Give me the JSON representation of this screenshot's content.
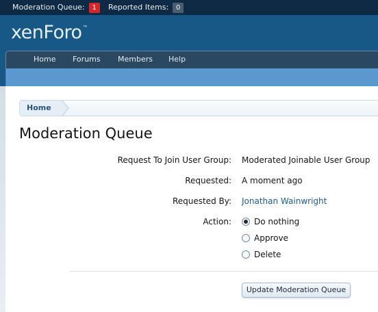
{
  "topbar": {
    "moderation_queue_label": "Moderation Queue:",
    "moderation_queue_count": "1",
    "reported_items_label": "Reported Items:",
    "reported_items_count": "0"
  },
  "header": {
    "logo_text": "xenForo",
    "logo_tm": "™"
  },
  "nav": {
    "tabs": [
      {
        "label": "Home"
      },
      {
        "label": "Forums"
      },
      {
        "label": "Members"
      },
      {
        "label": "Help"
      }
    ]
  },
  "breadcrumb": {
    "items": [
      {
        "label": "Home"
      }
    ]
  },
  "page": {
    "title": "Moderation Queue"
  },
  "form": {
    "request_label": "Request To Join User Group:",
    "request_value": "Moderated Joinable User Group",
    "requested_label": "Requested:",
    "requested_value": "A moment ago",
    "requested_by_label": "Requested By:",
    "requested_by_value": "Jonathan Wainwright",
    "action_label": "Action:",
    "actions": [
      {
        "label": "Do nothing",
        "selected": true
      },
      {
        "label": "Approve",
        "selected": false
      },
      {
        "label": "Delete",
        "selected": false
      }
    ],
    "submit_label": "Update Moderation Queue"
  },
  "colors": {
    "topbar": "#0f2a44",
    "header": "#185886",
    "nav": "#2b4862",
    "subnav": "#5b98cf",
    "link": "#1e5a92",
    "alert_badge": "#d7262a"
  }
}
